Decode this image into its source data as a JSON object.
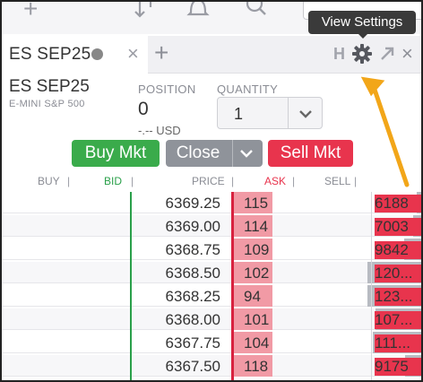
{
  "tooltip": {
    "text": "View Settings"
  },
  "tab": {
    "title": "ES SEP25"
  },
  "header_buttons": {
    "h_label": "H"
  },
  "instrument": {
    "symbol": "ES SEP25",
    "description": "E-MINI S&P 500"
  },
  "position": {
    "label": "POSITION",
    "value": "0",
    "usd": "-.-- USD"
  },
  "quantity": {
    "label": "QUANTITY",
    "value": "1"
  },
  "actions": {
    "buy": "Buy Mkt",
    "close": "Close",
    "sell": "Sell Mkt"
  },
  "columns": {
    "buy": "BUY",
    "bid": "BID",
    "price": "PRICE",
    "ask": "ASK",
    "sell": "SELL"
  },
  "colors": {
    "buy": "#3aab4b",
    "close": "#8f939a",
    "sell": "#e8344d",
    "bid_line": "#2aa04a",
    "ask_line": "#d8223f",
    "annotation_arrow": "#f2a619"
  },
  "ladder": [
    {
      "price": "6369.25",
      "ask": "115",
      "sell": "6188",
      "sell_fill": 0.08
    },
    {
      "price": "6369.00",
      "ask": "114",
      "sell": "7003",
      "sell_fill": 0.15
    },
    {
      "price": "6368.75",
      "ask": "109",
      "sell": "9842",
      "sell_fill": 0.32
    },
    {
      "price": "6368.50",
      "ask": "102",
      "sell": "120...",
      "sell_fill": 1.0
    },
    {
      "price": "6368.25",
      "ask": "94",
      "sell": "123...",
      "sell_fill": 1.0
    },
    {
      "price": "6368.00",
      "ask": "101",
      "sell": "107...",
      "sell_fill": 0.85
    },
    {
      "price": "6367.75",
      "ask": "104",
      "sell": "111...",
      "sell_fill": 0.9
    },
    {
      "price": "6367.50",
      "ask": "118",
      "sell": "9175",
      "sell_fill": 0.3
    }
  ]
}
